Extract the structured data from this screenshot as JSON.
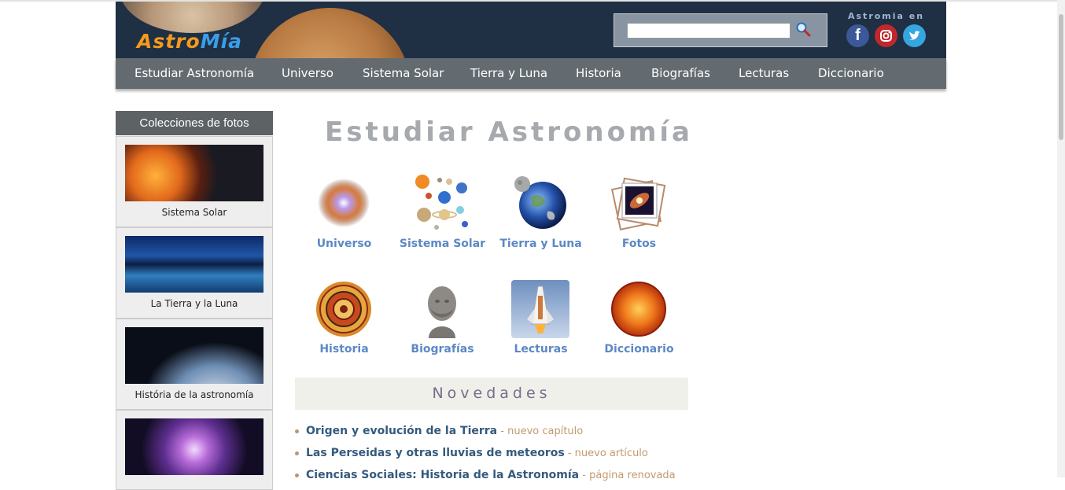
{
  "header": {
    "logo_part1": "Astro",
    "logo_part2": "Mía",
    "search": {
      "value": "",
      "placeholder": ""
    },
    "social_title": "Astromia en",
    "social": {
      "facebook": "f",
      "instagram": "◎",
      "twitter": "🐦"
    }
  },
  "nav": {
    "items": [
      "Estudiar Astronomía",
      "Universo",
      "Sistema Solar",
      "Tierra y Luna",
      "Historia",
      "Biografías",
      "Lecturas",
      "Diccionario"
    ]
  },
  "sidebar": {
    "title": "Colecciones de fotos",
    "photos": [
      "Sistema Solar",
      "La Tierra y la Luna",
      "História de la astronomía"
    ]
  },
  "main": {
    "title": "Estudiar Astronomía",
    "tiles": [
      "Universo",
      "Sistema Solar",
      "Tierra y Luna",
      "Fotos",
      "Historia",
      "Biografías",
      "Lecturas",
      "Diccionario"
    ],
    "novedades_title": "Novedades",
    "news": [
      {
        "title": "Origen y evolución de la Tierra",
        "note": " - nuevo capítulo"
      },
      {
        "title": "Las Perseidas y otras lluvias de meteoros",
        "note": " - nuevo artículo"
      },
      {
        "title": "Ciencias Sociales: Historia de la Astronomía",
        "note": " - página renovada"
      }
    ]
  },
  "colors": {
    "header_bg": "#1f2f44",
    "nav_bg": "#646b70",
    "link_blue": "#5c88c5",
    "news_title": "#345a7e",
    "news_note": "#c09a6e"
  }
}
